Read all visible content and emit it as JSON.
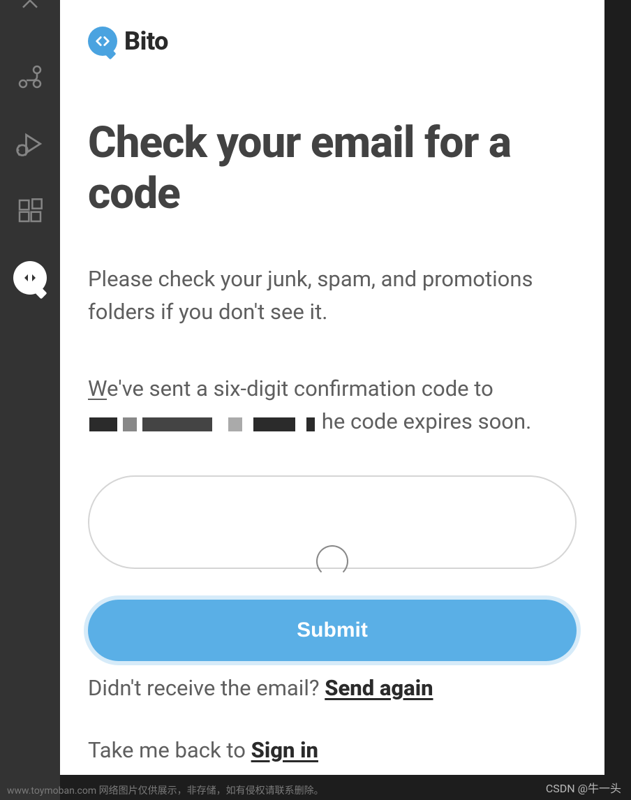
{
  "brand": {
    "name": "Bito"
  },
  "sidebar": {
    "items": [
      {
        "name": "explorer"
      },
      {
        "name": "source-control"
      },
      {
        "name": "run-debug"
      },
      {
        "name": "extensions"
      },
      {
        "name": "bito"
      }
    ]
  },
  "page": {
    "heading": "Check your email for a code",
    "instruction": "Please check your junk, spam, and promotions folders if you don't see it.",
    "sent_prefix_initial": "W",
    "sent_prefix_rest": "e've sent a six-digit confirmation code to ",
    "sent_suffix": "he code expires soon.",
    "code_value": "",
    "submit_label": "Submit",
    "resend_prompt": "Didn't receive the email? ",
    "resend_link": "Send again",
    "back_prompt": "Take me back to ",
    "back_link": "Sign in"
  },
  "watermark": {
    "left": "www.toymoban.com 网络图片仅供展示，非存储，如有侵权请联系删除。",
    "right": "CSDN @牛一头"
  }
}
